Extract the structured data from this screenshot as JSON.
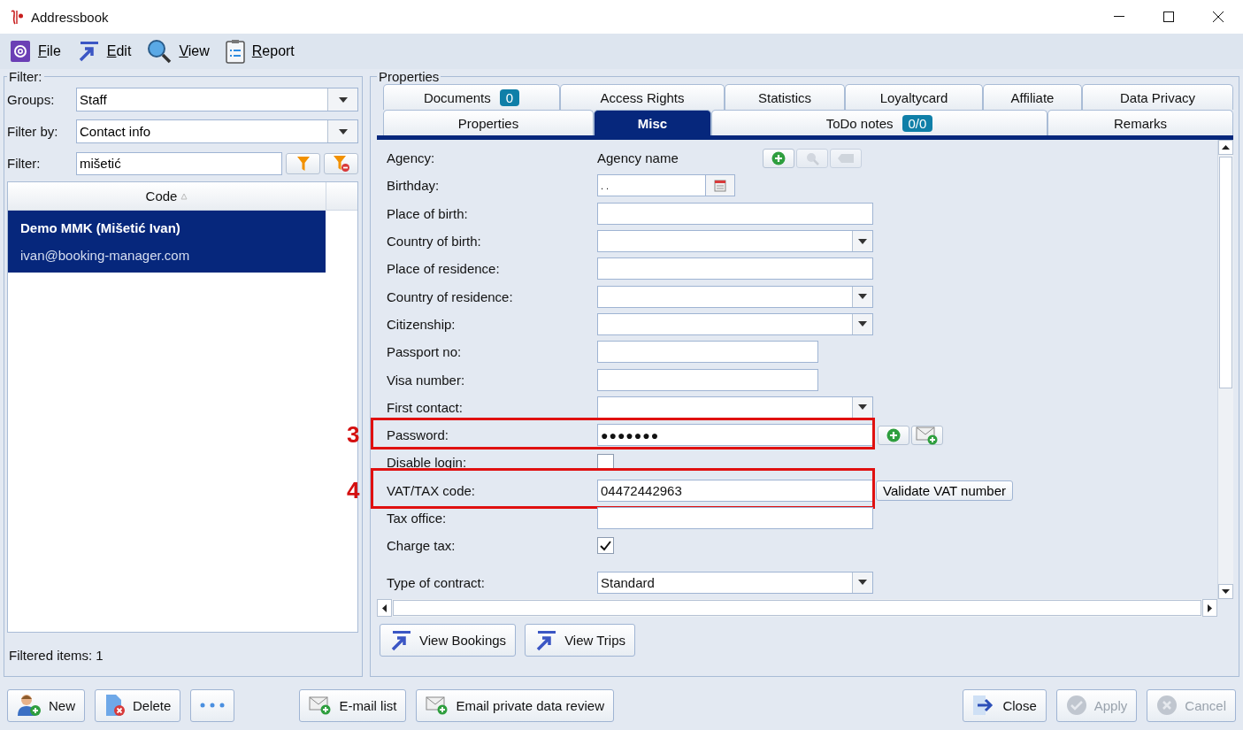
{
  "window": {
    "title": "Addressbook"
  },
  "menu": [
    {
      "label": "File"
    },
    {
      "label": "Edit"
    },
    {
      "label": "View"
    },
    {
      "label": "Report"
    }
  ],
  "filter": {
    "title": "Filter:",
    "groups": {
      "label": "Groups:",
      "value": "Staff"
    },
    "filter_by": {
      "label": "Filter by:",
      "value": "Contact info"
    },
    "filter": {
      "label": "Filter:",
      "value": "mišetić"
    },
    "table": {
      "columns": [
        {
          "label": "Code",
          "sorted": true
        }
      ],
      "rows": [
        {
          "name": "Demo MMK (Mišetić Ivan)",
          "email": "ivan@booking-manager.com",
          "selected": true
        }
      ]
    },
    "status": "Filtered items: 1"
  },
  "properties": {
    "title": "Properties",
    "tabs_back": [
      {
        "label": "Documents",
        "badge": "0"
      },
      {
        "label": "Access Rights"
      },
      {
        "label": "Statistics"
      },
      {
        "label": "Loyaltycard"
      },
      {
        "label": "Affiliate"
      },
      {
        "label": "Data Privacy"
      }
    ],
    "tabs_front": [
      {
        "label": "Properties",
        "selected": false
      },
      {
        "label": "Misc",
        "selected": true
      },
      {
        "label": "ToDo notes",
        "badge": "0/0",
        "selected": false
      },
      {
        "label": "Remarks",
        "selected": false
      }
    ],
    "fields": [
      {
        "kind": "text",
        "label": "Agency:",
        "value": "Agency name",
        "actions": [
          {
            "kind": "add",
            "disabled": false
          },
          {
            "kind": "search",
            "disabled": true
          },
          {
            "kind": "clear",
            "disabled": true
          }
        ]
      },
      {
        "kind": "date",
        "label": "Birthday:",
        "value": ". ."
      },
      {
        "kind": "input",
        "label": "Place of birth:"
      },
      {
        "kind": "combo",
        "label": "Country of birth:"
      },
      {
        "kind": "input",
        "label": "Place of residence:"
      },
      {
        "kind": "combo",
        "label": "Country of residence:"
      },
      {
        "kind": "combo",
        "label": "Citizenship:"
      },
      {
        "kind": "short",
        "label": "Passport no:"
      },
      {
        "kind": "short",
        "label": "Visa number:"
      },
      {
        "kind": "combo",
        "label": "First contact:"
      },
      {
        "kind": "password",
        "label": "Password:",
        "value": "●●●●●●●",
        "callout": "3",
        "actions": [
          {
            "kind": "add",
            "disabled": false
          },
          {
            "kind": "mail",
            "disabled": false
          }
        ]
      },
      {
        "kind": "checkbox",
        "label": "Disable login:",
        "checked": false
      },
      {
        "kind": "input",
        "label": "VAT/TAX code:",
        "value": "04472442963",
        "callout": "4",
        "button": "Validate VAT number"
      },
      {
        "kind": "input",
        "label": "Tax office:"
      },
      {
        "kind": "checkbox",
        "label": "Charge tax:",
        "checked": true
      },
      {
        "kind": "combo",
        "label": "Type of contract:",
        "value": "Standard"
      }
    ],
    "buttons": [
      {
        "label": "View Bookings"
      },
      {
        "label": "View Trips"
      }
    ]
  },
  "buttons": [
    {
      "label": "New",
      "disabled": false
    },
    {
      "label": "Delete",
      "disabled": false
    },
    {
      "disabled": false
    },
    {
      "label": "E-mail list",
      "disabled": false
    },
    {
      "label": "Email private data review",
      "disabled": false
    },
    {
      "label": "Close",
      "disabled": false
    },
    {
      "label": "Apply",
      "disabled": true
    },
    {
      "label": "Cancel",
      "disabled": true
    }
  ]
}
